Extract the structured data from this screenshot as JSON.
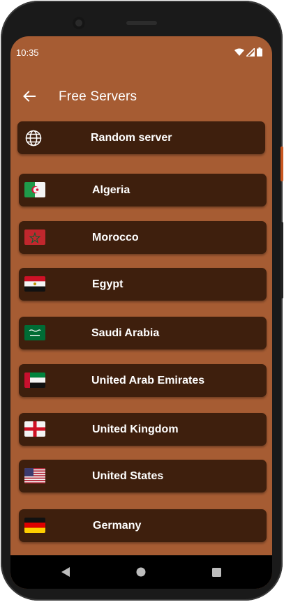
{
  "status": {
    "time": "10:35",
    "icons": [
      "wifi-icon",
      "signal-icon",
      "battery-icon"
    ]
  },
  "app_bar": {
    "title": "Free Servers",
    "back_icon": "arrow-left-icon"
  },
  "random_server": {
    "label": "Random server",
    "icon": "globe-icon"
  },
  "servers": [
    {
      "label": "Algeria",
      "flag": "algeria-flag-icon"
    },
    {
      "label": "Morocco",
      "flag": "morocco-flag-icon"
    },
    {
      "label": "Egypt",
      "flag": "egypt-flag-icon"
    },
    {
      "label": "Saudi Arabia",
      "flag": "saudi-arabia-flag-icon"
    },
    {
      "label": "United Arab Emirates",
      "flag": "uae-flag-icon"
    },
    {
      "label": "United Kingdom",
      "flag": "england-flag-icon"
    },
    {
      "label": "United States",
      "flag": "usa-flag-icon"
    },
    {
      "label": "Germany",
      "flag": "germany-flag-icon"
    }
  ],
  "nav": {
    "back": "nav-back-icon",
    "home": "nav-home-icon",
    "recents": "nav-recents-icon"
  },
  "colors": {
    "background": "#a65c33",
    "card": "#3e1f0d",
    "text": "#ffffff"
  }
}
